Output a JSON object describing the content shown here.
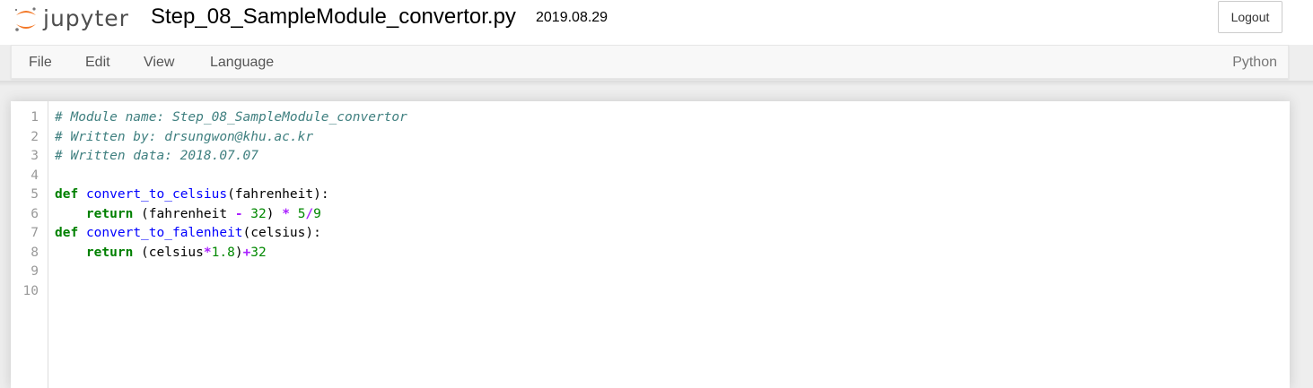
{
  "app": {
    "logo_text": "jupyter",
    "logo_icon": "jupyter-logo-icon",
    "notebook_title": "Step_08_SampleModule_convertor.py",
    "save_date": "2019.08.29",
    "logout_label": "Logout"
  },
  "menu": {
    "items": [
      "File",
      "Edit",
      "View",
      "Language"
    ],
    "mode": "Python"
  },
  "editor": {
    "line_numbers": [
      "1",
      "2",
      "3",
      "4",
      "5",
      "6",
      "7",
      "8",
      "9",
      "10"
    ],
    "lines": [
      [
        {
          "t": "comment",
          "v": "# Module name: Step_08_SampleModule_convertor"
        }
      ],
      [
        {
          "t": "comment",
          "v": "# Written by: drsungwon@khu.ac.kr"
        }
      ],
      [
        {
          "t": "comment",
          "v": "# Written data: 2018.07.07"
        }
      ],
      [],
      [
        {
          "t": "keyword",
          "v": "def"
        },
        {
          "t": "plain",
          "v": " "
        },
        {
          "t": "def",
          "v": "convert_to_celsius"
        },
        {
          "t": "plain",
          "v": "(fahrenheit):"
        }
      ],
      [
        {
          "t": "plain",
          "v": "    "
        },
        {
          "t": "keyword",
          "v": "return"
        },
        {
          "t": "plain",
          "v": " (fahrenheit "
        },
        {
          "t": "operator",
          "v": "-"
        },
        {
          "t": "plain",
          "v": " "
        },
        {
          "t": "number",
          "v": "32"
        },
        {
          "t": "plain",
          "v": ") "
        },
        {
          "t": "operator",
          "v": "*"
        },
        {
          "t": "plain",
          "v": " "
        },
        {
          "t": "number",
          "v": "5"
        },
        {
          "t": "operator",
          "v": "/"
        },
        {
          "t": "number",
          "v": "9"
        }
      ],
      [
        {
          "t": "keyword",
          "v": "def"
        },
        {
          "t": "plain",
          "v": " "
        },
        {
          "t": "def",
          "v": "convert_to_falenheit"
        },
        {
          "t": "plain",
          "v": "(celsius):"
        }
      ],
      [
        {
          "t": "plain",
          "v": "    "
        },
        {
          "t": "keyword",
          "v": "return"
        },
        {
          "t": "plain",
          "v": " (celsius"
        },
        {
          "t": "operator",
          "v": "*"
        },
        {
          "t": "number",
          "v": "1.8"
        },
        {
          "t": "plain",
          "v": ")"
        },
        {
          "t": "operator",
          "v": "+"
        },
        {
          "t": "number",
          "v": "32"
        }
      ],
      [],
      []
    ]
  },
  "colors": {
    "logo_orange": "#f37726",
    "comment": "#408080",
    "keyword": "#008000",
    "function_name": "#0000ff",
    "number": "#008800",
    "operator": "#aa22ff"
  }
}
